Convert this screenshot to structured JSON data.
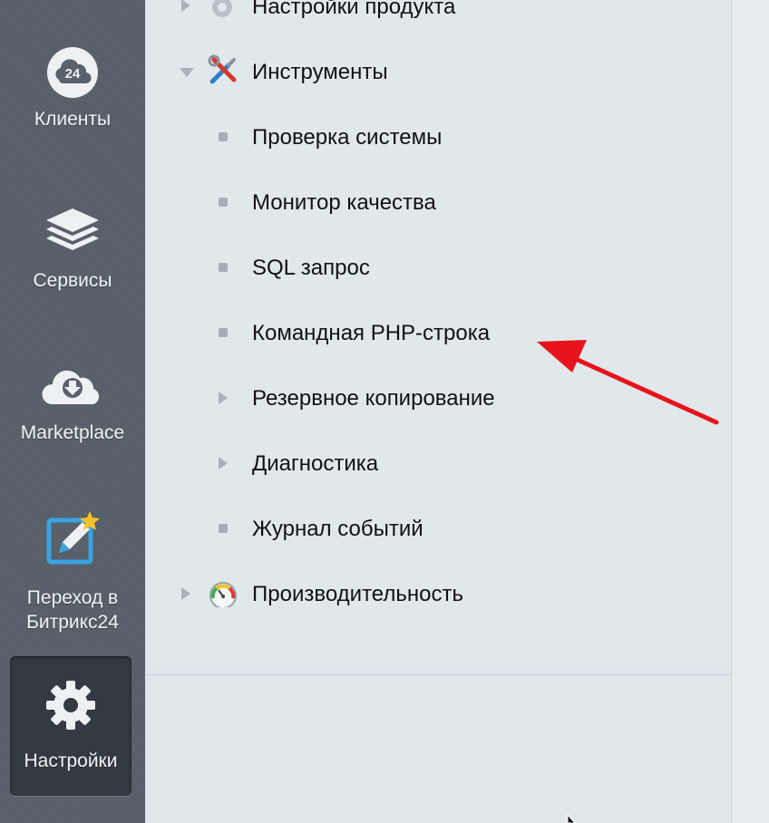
{
  "sidebar": {
    "items": [
      {
        "label": "Клиенты",
        "icon": "cloud-24-icon"
      },
      {
        "label": "Сервисы",
        "icon": "layers-icon"
      },
      {
        "label": "Marketplace",
        "icon": "cloud-download-icon"
      },
      {
        "label": "Переход в Битрикс24",
        "line1": "Переход в",
        "line2": "Битрикс24",
        "icon": "edit-star-icon"
      },
      {
        "label": "Настройки",
        "icon": "gear-icon",
        "active": true
      }
    ],
    "badge": "24"
  },
  "menu": {
    "items": [
      {
        "label": "Настройки продукта",
        "type": "section",
        "expanded": false,
        "icon": "gear-icon"
      },
      {
        "label": "Инструменты",
        "type": "section",
        "expanded": true,
        "icon": "tools-icon"
      },
      {
        "label": "Проверка системы",
        "type": "leaf"
      },
      {
        "label": "Монитор качества",
        "type": "leaf"
      },
      {
        "label": "SQL запрос",
        "type": "leaf"
      },
      {
        "label": "Командная PHP-строка",
        "type": "leaf",
        "highlighted": true
      },
      {
        "label": "Резервное копирование",
        "type": "subsection"
      },
      {
        "label": "Диагностика",
        "type": "subsection"
      },
      {
        "label": "Журнал событий",
        "type": "leaf"
      },
      {
        "label": "Производительность",
        "type": "section",
        "expanded": false,
        "icon": "speedometer-icon"
      }
    ]
  },
  "colors": {
    "sidebar_bg": "#5a626c",
    "active_bg": "#343a42",
    "panel_bg": "#e1e8ec",
    "annotation": "#e8141b"
  }
}
